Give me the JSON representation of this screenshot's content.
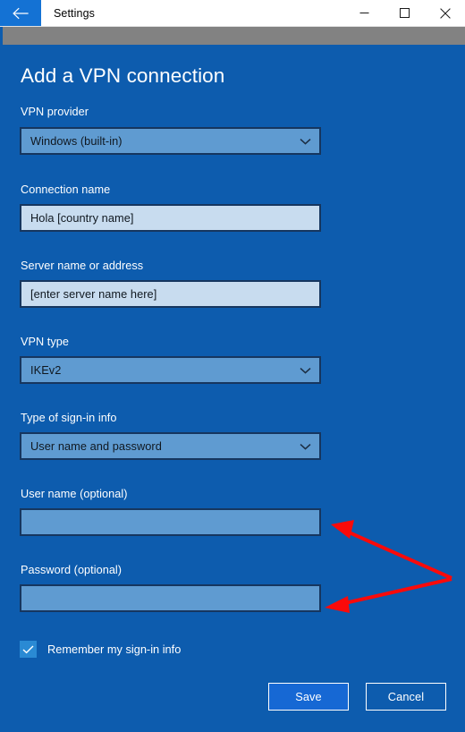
{
  "window": {
    "title": "Settings",
    "back_icon": "arrow-left-icon",
    "controls": [
      {
        "name": "minimize",
        "icon": "minimize-icon"
      },
      {
        "name": "maximize",
        "icon": "maximize-icon"
      },
      {
        "name": "close",
        "icon": "close-icon"
      }
    ]
  },
  "page": {
    "heading": "Add a VPN connection"
  },
  "fields": [
    {
      "label": "VPN provider",
      "value": "Windows (built-in)",
      "type": "dropdown",
      "name": "vpn-provider"
    },
    {
      "label": "Connection name",
      "value": "Hola [country name]",
      "type": "text",
      "name": "connection-name"
    },
    {
      "label": "Server name or address",
      "value": "[enter server name here]",
      "type": "text",
      "name": "server-name"
    },
    {
      "label": "VPN type",
      "value": "IKEv2",
      "type": "dropdown",
      "name": "vpn-type"
    },
    {
      "label": "Type of sign-in info",
      "value": "User name and password",
      "type": "dropdown",
      "name": "sign-in-type"
    },
    {
      "label": "User name (optional)",
      "value": "",
      "type": "empty",
      "name": "user-name"
    },
    {
      "label": "Password (optional)",
      "value": "",
      "type": "empty",
      "name": "password"
    }
  ],
  "checkbox": {
    "label": "Remember my sign-in info",
    "checked": true
  },
  "buttons": {
    "save": "Save",
    "cancel": "Cancel"
  },
  "colors": {
    "page_background": "#0d5cae",
    "titlebar_background": "#ffffff",
    "gray_strip": "#828282",
    "back_button": "#1472d4",
    "text_input_fill": "#c8dcef",
    "dropdown_fill": "#5f9bd1",
    "field_border": "#16365f",
    "save_button_fill": "#1668d4",
    "checkbox_fill": "#2a8ad4",
    "annotation_arrow": "#fa0a0a"
  },
  "annotations": [
    {
      "name": "arrow-to-user-name-field",
      "color": "#fa0a0a"
    },
    {
      "name": "arrow-to-password-field",
      "color": "#fa0a0a"
    }
  ]
}
